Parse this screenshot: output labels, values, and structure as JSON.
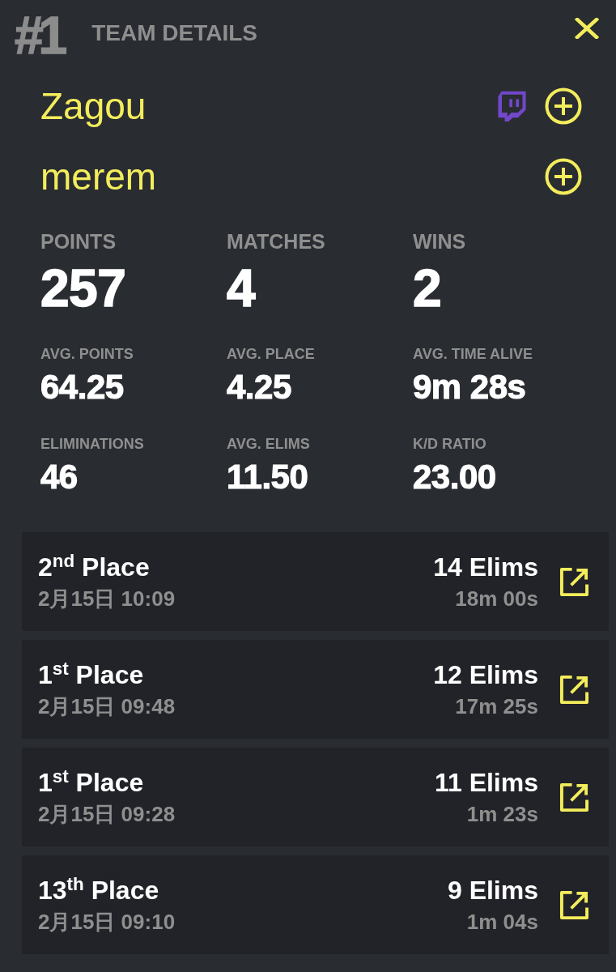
{
  "header": {
    "rank": "#1",
    "title": "TEAM DETAILS"
  },
  "players": [
    {
      "name": "Zagou",
      "stream_badge": true
    },
    {
      "name": "merem",
      "stream_badge": false
    }
  ],
  "stats": [
    {
      "kind": "primary",
      "items": [
        {
          "label": "POINTS",
          "value": "257"
        },
        {
          "label": "MATCHES",
          "value": "4"
        },
        {
          "label": "WINS",
          "value": "2"
        }
      ]
    },
    {
      "kind": "secondary",
      "items": [
        {
          "label": "AVG. POINTS",
          "value": "64.25"
        },
        {
          "label": "AVG. PLACE",
          "value": "4.25"
        },
        {
          "label": "AVG. TIME ALIVE",
          "value": "9m 28s"
        }
      ]
    },
    {
      "kind": "secondary",
      "items": [
        {
          "label": "ELIMINATIONS",
          "value": "46"
        },
        {
          "label": "AVG. ELIMS",
          "value": "11.50"
        },
        {
          "label": "K/D RATIO",
          "value": "23.00"
        }
      ]
    }
  ],
  "matches": [
    {
      "place": "2$^{nd}$ Place",
      "date": "2月15日 10:09",
      "elims": "14 Elims",
      "duration": "18m 00s"
    },
    {
      "place": "1$^{st}$ Place",
      "date": "2月15日 09:48",
      "elims": "12 Elims",
      "duration": "17m 25s"
    },
    {
      "place": "1$^{st}$ Place",
      "date": "2月15日 09:28",
      "elims": "11 Elims",
      "duration": "1m 23s"
    },
    {
      "place": "13$^{th}$ Place",
      "date": "2月15日 09:10",
      "elims": "9 Elims",
      "duration": "1m 04s"
    }
  ]
}
